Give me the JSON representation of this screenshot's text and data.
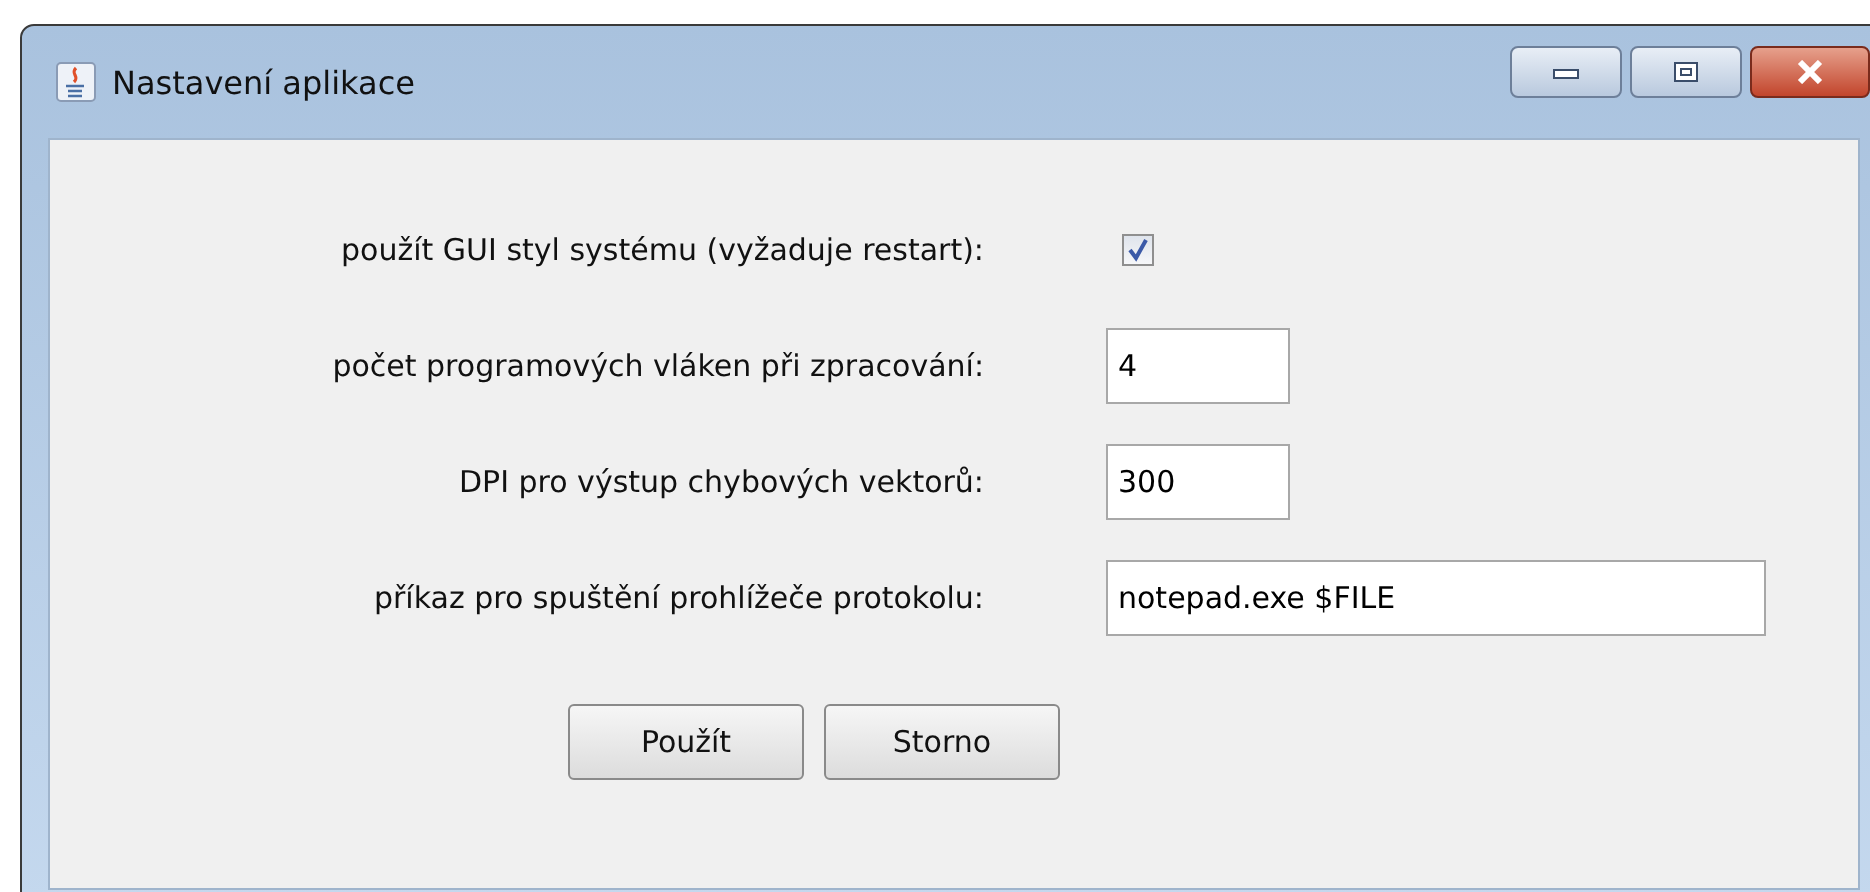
{
  "window": {
    "title": "Nastavení aplikace"
  },
  "settings": [
    {
      "kind": "checkbox",
      "label": "použít GUI styl systému (vyžaduje restart):",
      "checked": true
    },
    {
      "kind": "field",
      "label": "počet programových vláken při zpracování:",
      "value": "4"
    },
    {
      "kind": "field",
      "label": "DPI pro výstup chybových vektorů:",
      "value": "300"
    },
    {
      "kind": "widefield",
      "label": "příkaz pro spuštění prohlížeče protokolu:",
      "value": "notepad.exe $FILE"
    }
  ],
  "buttons": [
    "Použít",
    "Storno"
  ]
}
